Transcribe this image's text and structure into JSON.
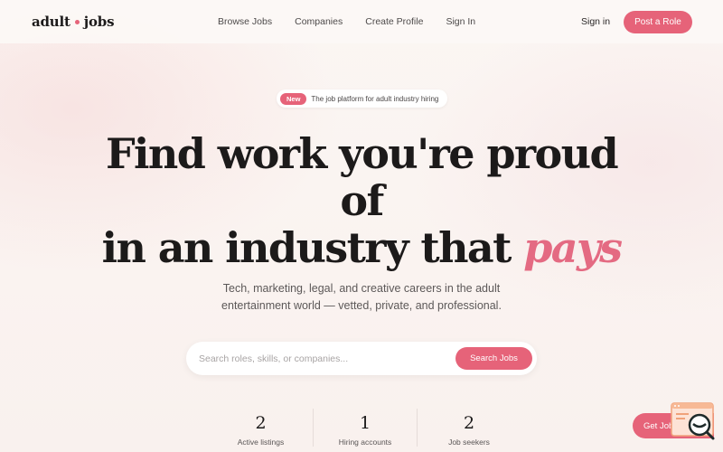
{
  "logo": {
    "left": "adult",
    "right": "jobs"
  },
  "nav": {
    "items": [
      "Browse Jobs",
      "Companies",
      "Create Profile",
      "Sign In"
    ],
    "sign_in": "Sign in",
    "post_role": "Post a Role"
  },
  "announcement": {
    "badge": "New",
    "text": "The job platform for adult industry hiring"
  },
  "hero": {
    "line1": "Find work you're proud",
    "line2": "of",
    "line3_start": "in an industry that ",
    "line3_accent": "pays",
    "subtitle_line1": "Tech, marketing, legal, and creative careers in the adult",
    "subtitle_line2": "entertainment world — vetted, private, and professional."
  },
  "search": {
    "placeholder": "Search roles, skills, or companies...",
    "value": "",
    "button": "Search Jobs"
  },
  "stats": [
    {
      "value": "2",
      "label": "Active listings"
    },
    {
      "value": "1",
      "label": "Hiring accounts"
    },
    {
      "value": "2",
      "label": "Job seekers"
    }
  ],
  "floating": {
    "alert_button": "Get Job Alerts",
    "widget_icon": "chat-search-icon"
  },
  "colors": {
    "accent": "#e66379",
    "text": "#1c1a1a",
    "background": "#fbf4f1"
  }
}
